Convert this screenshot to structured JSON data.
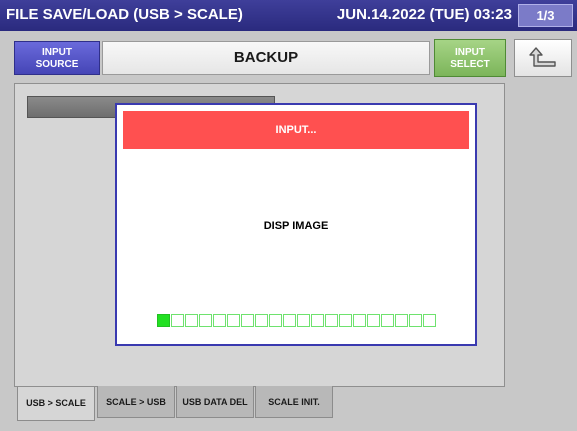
{
  "titlebar": {
    "title": "FILE SAVE/LOAD (USB > SCALE)",
    "datetime": "JUN.14.2022 (TUE)  03:23",
    "page": "1/3"
  },
  "header": {
    "input_source_line1": "INPUT",
    "input_source_line2": "SOURCE",
    "title": "BACKUP",
    "input_select_line1": "INPUT",
    "input_select_line2": "SELECT",
    "back_icon": "return-arrow-icon"
  },
  "tabs": [
    {
      "label": "USB > SCALE",
      "active": true
    },
    {
      "label": "SCALE > USB",
      "active": false
    },
    {
      "label": "USB DATA DEL",
      "active": false
    },
    {
      "label": "SCALE INIT.",
      "active": false
    }
  ],
  "modal": {
    "header": "INPUT...",
    "message": "DISP IMAGE",
    "progress": {
      "filled": 1,
      "total": 20
    }
  },
  "colors": {
    "titlebar": "#2a2a7e",
    "modal_header": "#ff5050",
    "progress_on": "#22e022",
    "progress_off_border": "#6ee26e",
    "input_select": "#7cb55a"
  }
}
